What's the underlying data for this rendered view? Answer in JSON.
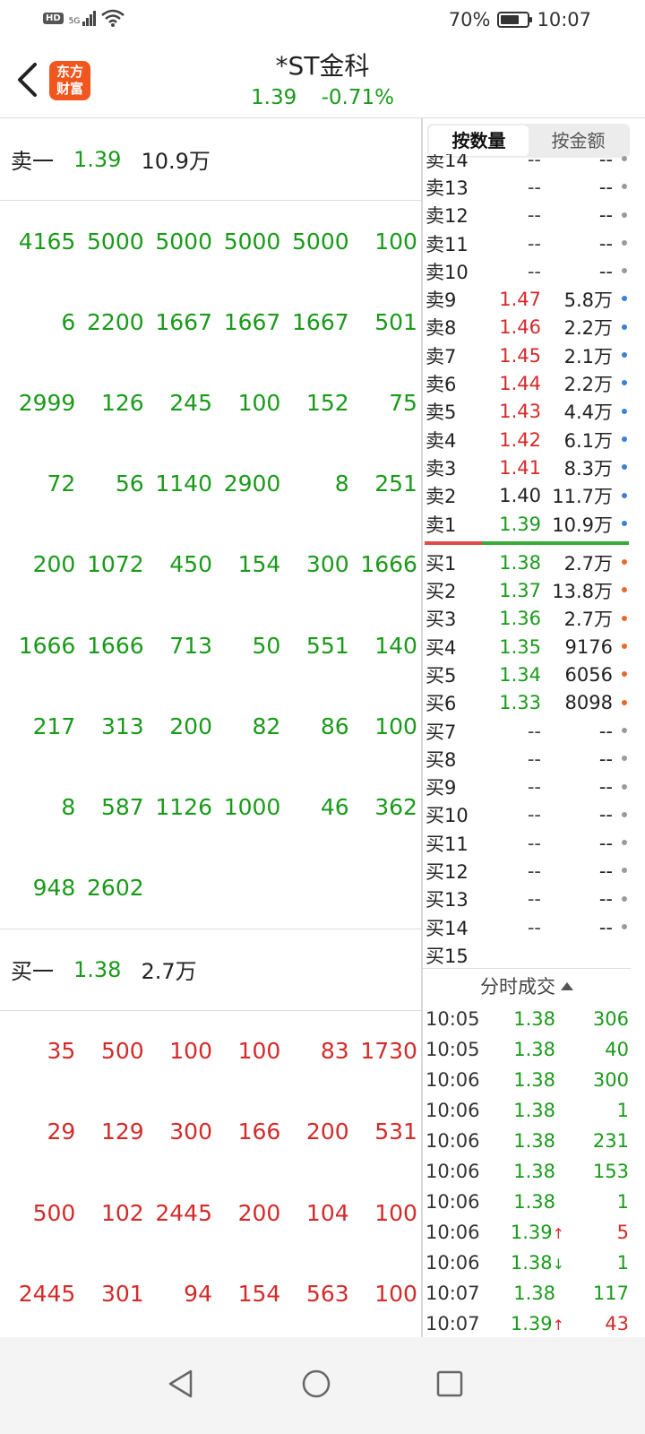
{
  "status_bar": {
    "hd": "HD",
    "network": "5G",
    "battery_text": "70%",
    "battery_level": 0.7,
    "time": "10:07"
  },
  "header": {
    "logo_line1": "东方",
    "logo_line2": "财富",
    "title": "*ST金科",
    "price": "1.39",
    "change": "-0.71%"
  },
  "left": {
    "ask": {
      "label": "卖一",
      "price": "1.39",
      "volume": "10.9万"
    },
    "ask_orders": [
      [
        "4165",
        "5000",
        "5000",
        "5000",
        "5000",
        "100"
      ],
      [
        "6",
        "2200",
        "1667",
        "1667",
        "1667",
        "501"
      ],
      [
        "2999",
        "126",
        "245",
        "100",
        "152",
        "75"
      ],
      [
        "72",
        "56",
        "1140",
        "2900",
        "8",
        "251"
      ],
      [
        "200",
        "1072",
        "450",
        "154",
        "300",
        "1666"
      ],
      [
        "1666",
        "1666",
        "713",
        "50",
        "551",
        "140"
      ],
      [
        "217",
        "313",
        "200",
        "82",
        "86",
        "100"
      ],
      [
        "8",
        "587",
        "1126",
        "1000",
        "46",
        "362"
      ],
      [
        "948",
        "2602",
        "",
        "",
        "",
        ""
      ]
    ],
    "bid": {
      "label": "买一",
      "price": "1.38",
      "volume": "2.7万"
    },
    "bid_orders": [
      [
        "35",
        "500",
        "100",
        "100",
        "83",
        "1730"
      ],
      [
        "29",
        "129",
        "300",
        "166",
        "200",
        "531"
      ],
      [
        "500",
        "102",
        "2445",
        "200",
        "104",
        "100"
      ],
      [
        "2445",
        "301",
        "94",
        "154",
        "563",
        "100"
      ]
    ]
  },
  "right": {
    "tabs": [
      "按数量",
      "按金额"
    ],
    "asks": [
      {
        "label": "卖14",
        "price": "--",
        "vol": "--",
        "color": "gray"
      },
      {
        "label": "卖13",
        "price": "--",
        "vol": "--",
        "color": "gray"
      },
      {
        "label": "卖12",
        "price": "--",
        "vol": "--",
        "color": "gray"
      },
      {
        "label": "卖11",
        "price": "--",
        "vol": "--",
        "color": "gray"
      },
      {
        "label": "卖10",
        "price": "--",
        "vol": "--",
        "color": "gray"
      },
      {
        "label": "卖9",
        "price": "1.47",
        "vol": "5.8万",
        "color": "red"
      },
      {
        "label": "卖8",
        "price": "1.46",
        "vol": "2.2万",
        "color": "red"
      },
      {
        "label": "卖7",
        "price": "1.45",
        "vol": "2.1万",
        "color": "red"
      },
      {
        "label": "卖6",
        "price": "1.44",
        "vol": "2.2万",
        "color": "red"
      },
      {
        "label": "卖5",
        "price": "1.43",
        "vol": "4.4万",
        "color": "red"
      },
      {
        "label": "卖4",
        "price": "1.42",
        "vol": "6.1万",
        "color": "red"
      },
      {
        "label": "卖3",
        "price": "1.41",
        "vol": "8.3万",
        "color": "red"
      },
      {
        "label": "卖2",
        "price": "1.40",
        "vol": "11.7万",
        "color": "black"
      },
      {
        "label": "卖1",
        "price": "1.39",
        "vol": "10.9万",
        "color": "green"
      }
    ],
    "bids": [
      {
        "label": "买1",
        "price": "1.38",
        "vol": "2.7万",
        "color": "green"
      },
      {
        "label": "买2",
        "price": "1.37",
        "vol": "13.8万",
        "color": "green"
      },
      {
        "label": "买3",
        "price": "1.36",
        "vol": "2.7万",
        "color": "green"
      },
      {
        "label": "买4",
        "price": "1.35",
        "vol": "9176",
        "color": "green"
      },
      {
        "label": "买5",
        "price": "1.34",
        "vol": "6056",
        "color": "green"
      },
      {
        "label": "买6",
        "price": "1.33",
        "vol": "8098",
        "color": "green"
      },
      {
        "label": "买7",
        "price": "--",
        "vol": "--",
        "color": "gray"
      },
      {
        "label": "买8",
        "price": "--",
        "vol": "--",
        "color": "gray"
      },
      {
        "label": "买9",
        "price": "--",
        "vol": "--",
        "color": "gray"
      },
      {
        "label": "买10",
        "price": "--",
        "vol": "--",
        "color": "gray"
      },
      {
        "label": "买11",
        "price": "--",
        "vol": "--",
        "color": "gray"
      },
      {
        "label": "买12",
        "price": "--",
        "vol": "--",
        "color": "gray"
      },
      {
        "label": "买13",
        "price": "--",
        "vol": "--",
        "color": "gray"
      },
      {
        "label": "买14",
        "price": "--",
        "vol": "--",
        "color": "gray"
      },
      {
        "label": "买15",
        "price": "",
        "vol": "",
        "color": "gray"
      }
    ],
    "trades_title": "分时成交",
    "trades": [
      {
        "time": "10:05",
        "price": "1.38",
        "arrow": "",
        "vol": "306",
        "side": "buy"
      },
      {
        "time": "10:05",
        "price": "1.38",
        "arrow": "",
        "vol": "40",
        "side": "buy"
      },
      {
        "time": "10:06",
        "price": "1.38",
        "arrow": "",
        "vol": "300",
        "side": "buy"
      },
      {
        "time": "10:06",
        "price": "1.38",
        "arrow": "",
        "vol": "1",
        "side": "buy"
      },
      {
        "time": "10:06",
        "price": "1.38",
        "arrow": "",
        "vol": "231",
        "side": "buy"
      },
      {
        "time": "10:06",
        "price": "1.38",
        "arrow": "",
        "vol": "153",
        "side": "buy"
      },
      {
        "time": "10:06",
        "price": "1.38",
        "arrow": "",
        "vol": "1",
        "side": "buy"
      },
      {
        "time": "10:06",
        "price": "1.39",
        "arrow": "↑",
        "vol": "5",
        "side": "sell"
      },
      {
        "time": "10:06",
        "price": "1.38",
        "arrow": "↓",
        "vol": "1",
        "side": "buy"
      },
      {
        "time": "10:07",
        "price": "1.38",
        "arrow": "",
        "vol": "117",
        "side": "buy"
      },
      {
        "time": "10:07",
        "price": "1.39",
        "arrow": "↑",
        "vol": "43",
        "side": "sell"
      }
    ]
  },
  "colors": {
    "green": "#1a9a1a",
    "red": "#d42a2a",
    "logo": "#f0561e"
  },
  "nav": {
    "icons": [
      "back-triangle-icon",
      "home-circle-icon",
      "recents-square-icon"
    ]
  }
}
